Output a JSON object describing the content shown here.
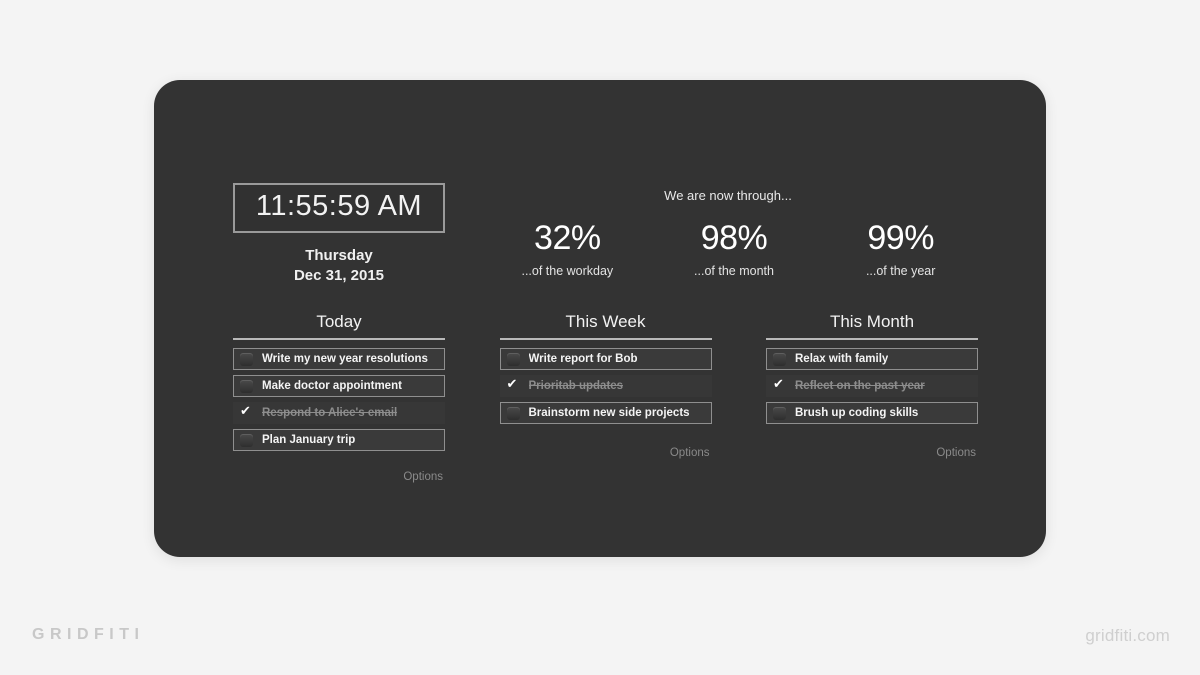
{
  "watermark": {
    "brand": "GRIDFITI",
    "site": "gridfiti.com"
  },
  "clock": {
    "time": "11:55:59 AM",
    "day": "Thursday",
    "date": "Dec 31, 2015"
  },
  "progress": {
    "heading": "We are now through...",
    "stats": [
      {
        "value": "32%",
        "label": "...of the workday"
      },
      {
        "value": "98%",
        "label": "...of the month"
      },
      {
        "value": "99%",
        "label": "...of the year"
      }
    ]
  },
  "columns": [
    {
      "title": "Today",
      "options_label": "Options",
      "tasks": [
        {
          "text": "Write my new year resolutions",
          "done": false
        },
        {
          "text": "Make doctor appointment",
          "done": false
        },
        {
          "text": "Respond to Alice's email",
          "done": true
        },
        {
          "text": "Plan January trip",
          "done": false
        }
      ]
    },
    {
      "title": "This Week",
      "options_label": "Options",
      "tasks": [
        {
          "text": "Write report for Bob",
          "done": false
        },
        {
          "text": "Prioritab updates",
          "done": true
        },
        {
          "text": "Brainstorm new side projects",
          "done": false
        }
      ]
    },
    {
      "title": "This Month",
      "options_label": "Options",
      "tasks": [
        {
          "text": "Relax with family",
          "done": false
        },
        {
          "text": "Reflect on the past year",
          "done": true
        },
        {
          "text": "Brush up coding skills",
          "done": false
        }
      ]
    }
  ],
  "colors": {
    "page_background": "#f4f4f4",
    "panel_background": "#333333",
    "text_primary": "#f4f4f4",
    "text_muted": "#8a8a8a",
    "rule": "#b9b9b9",
    "task_border": "#8f8f8f"
  }
}
